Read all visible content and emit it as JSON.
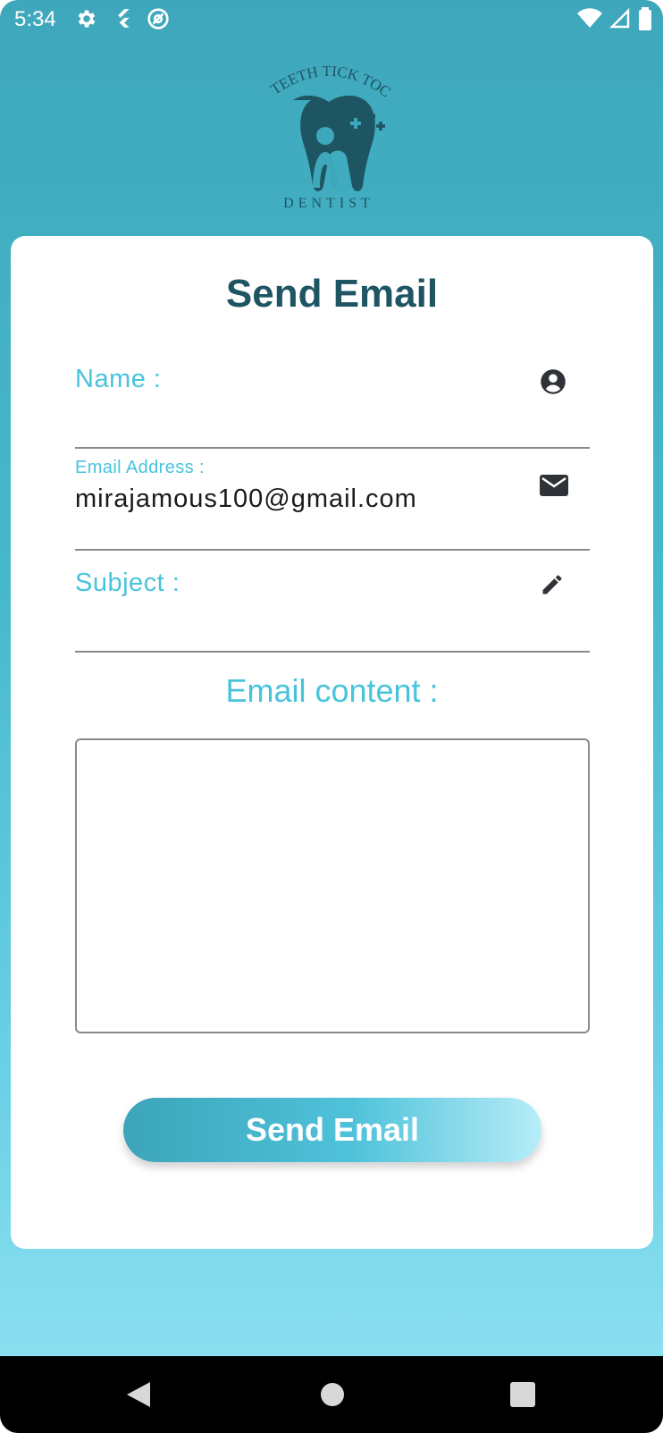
{
  "status_bar": {
    "time": "5:34",
    "left_icons": [
      "gear-icon",
      "flutter-icon",
      "at-sign-icon"
    ],
    "right_icons": [
      "wifi-icon",
      "signal-icon",
      "battery-icon"
    ]
  },
  "logo": {
    "top_text": "TEETH TICK TOCK",
    "bottom_text": "DENTIST",
    "color": "#1e5563"
  },
  "card": {
    "title": "Send Email"
  },
  "form": {
    "name": {
      "label": "Name :",
      "value": "",
      "icon": "account-circle-icon"
    },
    "email": {
      "label": "Email Address :",
      "value": "mirajamous100@gmail.com",
      "icon": "mail-icon"
    },
    "subject": {
      "label": "Subject :",
      "value": "",
      "icon": "pencil-icon"
    },
    "content": {
      "label": "Email content :",
      "value": ""
    }
  },
  "send_button": {
    "label": "Send Email"
  },
  "nav": {
    "back": "back-icon",
    "home": "home-icon",
    "recents": "recents-icon"
  },
  "colors": {
    "accent": "#48c3dc",
    "title": "#1e5563",
    "background_top": "#3fa7bb",
    "background_bottom": "#93e3f2"
  }
}
